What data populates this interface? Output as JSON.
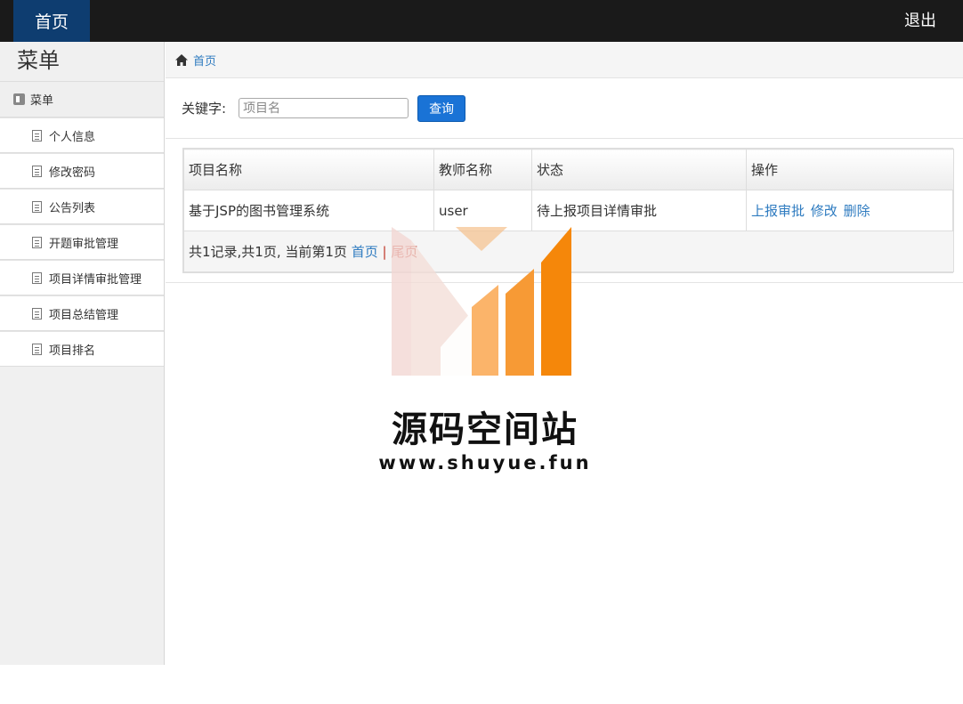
{
  "topbar": {
    "home_label": "首页",
    "logout_label": "退出"
  },
  "sidebar": {
    "title": "菜单",
    "group_label": "菜单",
    "items": [
      {
        "label": "个人信息"
      },
      {
        "label": "修改密码"
      },
      {
        "label": "公告列表"
      },
      {
        "label": "开题审批管理"
      },
      {
        "label": "项目详情审批管理"
      },
      {
        "label": "项目总结管理"
      },
      {
        "label": "项目排名"
      }
    ]
  },
  "breadcrumb": {
    "home": "首页"
  },
  "search": {
    "label": "关键字:",
    "placeholder": "项目名",
    "button": "查询"
  },
  "table": {
    "headers": [
      "项目名称",
      "教师名称",
      "状态",
      "操作"
    ],
    "rows": [
      {
        "project": "基于JSP的图书管理系统",
        "teacher": "user",
        "status": "待上报项目详情审批",
        "actions": [
          "上报审批",
          "修改",
          "删除"
        ]
      }
    ]
  },
  "pager": {
    "summary": "共1记录,共1页, 当前第1页",
    "first": "首页",
    "separator": "|",
    "last": "尾页"
  },
  "watermark": {
    "name": "源码空间站",
    "url": "www.shuyue.fun"
  },
  "colors": {
    "topbar": "#1a1a1a",
    "active_tab": "#0e3d70",
    "link": "#2e7bc0",
    "button": "#1a73d6",
    "logo_orange": "#f5870a"
  }
}
